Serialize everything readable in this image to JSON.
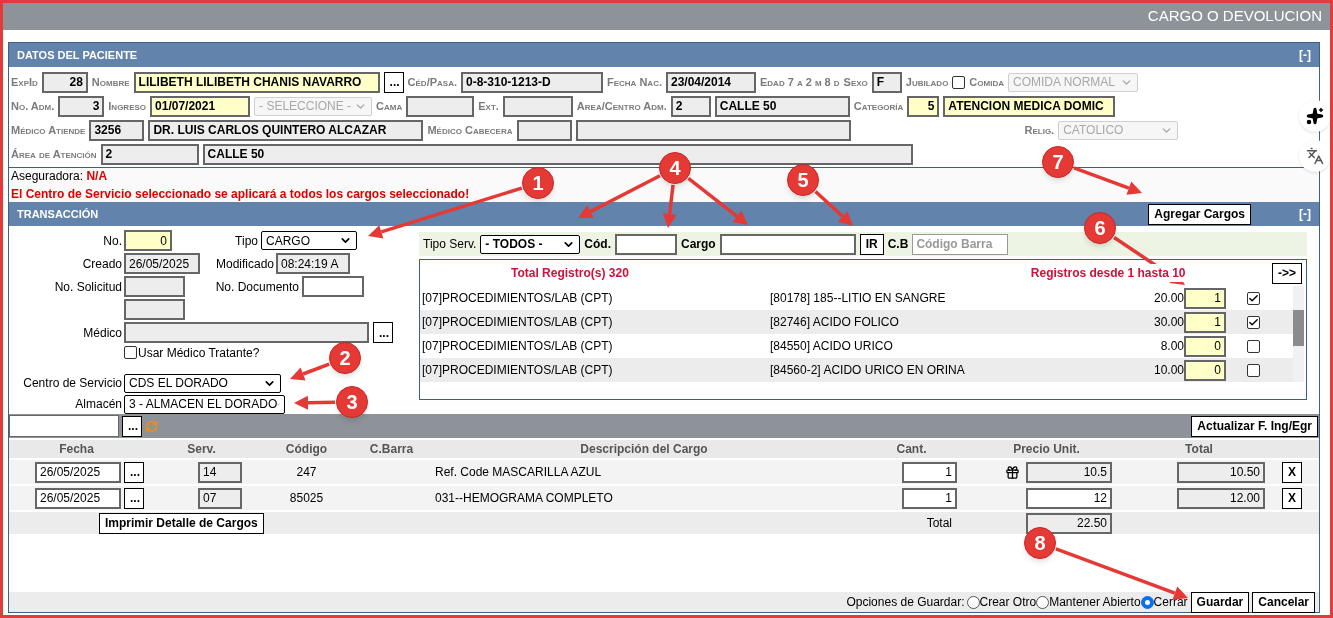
{
  "window": {
    "title": "CARGO O DEVOLUCION"
  },
  "patient": {
    "title": "DATOS DEL PACIENTE",
    "collapse": "[-]",
    "lines": [
      {
        "items": [
          {
            "kind": "label",
            "text": "ExpId"
          },
          {
            "kind": "field",
            "value": "28",
            "highlighted": false
          },
          {
            "kind": "label",
            "text": "Nombre"
          },
          {
            "kind": "field",
            "value": "LILIBETH LILIBETH CHANIS NAVARRO",
            "highlighted": true
          },
          {
            "kind": "button",
            "text": "..."
          },
          {
            "kind": "label",
            "text": "Céd/Pasa."
          },
          {
            "kind": "field",
            "value": "0-8-310-1213-D",
            "highlighted": false
          },
          {
            "kind": "label",
            "text": "Fecha Nac."
          },
          {
            "kind": "field",
            "value": "23/04/2014",
            "highlighted": false
          },
          {
            "kind": "label",
            "text": "Edad 7 a  2 m  8 d"
          },
          {
            "kind": "label",
            "text": "Sexo"
          },
          {
            "kind": "field",
            "value": "F",
            "highlighted": false
          },
          {
            "kind": "label",
            "text": "Jubilado"
          },
          {
            "kind": "checkbox",
            "checked": false
          },
          {
            "kind": "label",
            "text": "Comida"
          },
          {
            "kind": "select",
            "value": "COMIDA NORMAL",
            "disabled": true
          }
        ]
      },
      {
        "items": [
          {
            "kind": "label",
            "text": "No. Adm."
          },
          {
            "kind": "field",
            "value": "3",
            "highlighted": false
          },
          {
            "kind": "label",
            "text": "Ingreso"
          },
          {
            "kind": "field",
            "value": "01/07/2021",
            "highlighted": true
          },
          {
            "kind": "select",
            "value": "- SELECCIONE -",
            "disabled": true
          },
          {
            "kind": "label",
            "text": "Cama"
          },
          {
            "kind": "field",
            "highlighted": false
          },
          {
            "kind": "label",
            "text": "Ext."
          },
          {
            "kind": "field",
            "highlighted": false
          },
          {
            "kind": "label",
            "text": "Area/Centro Adm."
          },
          {
            "kind": "field",
            "value": "2",
            "highlighted": false
          },
          {
            "kind": "field",
            "value": "CALLE 50",
            "highlighted": false
          },
          {
            "kind": "label",
            "text": "Categoría"
          },
          {
            "kind": "field",
            "value": "5",
            "highlighted": true
          },
          {
            "kind": "field",
            "value": "ATENCION MEDICA DOMIC",
            "highlighted": true
          }
        ]
      },
      {
        "items": [
          {
            "kind": "label",
            "text": "Médico Atiende"
          },
          {
            "kind": "field",
            "value": "3256",
            "highlighted": false
          },
          {
            "kind": "field",
            "value": "DR. LUIS CARLOS QUINTERO ALCAZAR",
            "highlighted": false
          },
          {
            "kind": "label",
            "text": "Médico Cabecera"
          },
          {
            "kind": "field",
            "highlighted": false
          },
          {
            "kind": "field",
            "highlighted": false
          },
          {
            "kind": "label",
            "text": "Relig."
          },
          {
            "kind": "select",
            "value": "CATOLICO",
            "disabled": true
          }
        ]
      },
      {
        "items": [
          {
            "kind": "label",
            "text": "Área de Atención"
          },
          {
            "kind": "field",
            "value": "2",
            "highlighted": false
          },
          {
            "kind": "field",
            "value": "CALLE 50",
            "highlighted": false
          }
        ]
      }
    ]
  },
  "insurer": {
    "label": "Aseguradora:",
    "value": "N/A"
  },
  "notice": "El Centro de Servicio seleccionado se aplicará a todos los cargos seleccionado!",
  "transaction": {
    "title": "TRANSACCIÓN",
    "collapse": "[-]",
    "add_button": "Agregar Cargos",
    "form": {
      "no": {
        "label": "No.",
        "value": "0"
      },
      "tipo": {
        "label": "Tipo",
        "value": "CARGO"
      },
      "creado": {
        "label": "Creado",
        "value": "26/05/2025"
      },
      "modificado": {
        "label": "Modificado",
        "value": "08:24:19 A"
      },
      "solicitud": {
        "label": "No. Solicitud"
      },
      "documento": {
        "label": "No. Documento"
      },
      "medico": {
        "label": "Médico",
        "button": "..."
      },
      "tratante": {
        "label": "Usar Médico Tratante?",
        "checked": false
      },
      "centro": {
        "label": "Centro de Servicio",
        "value": "CDS EL DORADO"
      },
      "almacen": {
        "label": "Almacén",
        "value": "3 - ALMACEN EL DORADO"
      }
    },
    "filter": {
      "tipo_label": "Tipo Serv.",
      "tipo_value": "- TODOS -",
      "cod_label": "Cód.",
      "cargo_label": "Cargo",
      "go_button": "IR",
      "cb_label": "C.B",
      "cb_placeholder": "Código Barra"
    },
    "results": {
      "total": "Total Registro(s) 320",
      "range": "Registros desde 1 hasta 10",
      "next_button": "->>",
      "rows": [
        {
          "service": "[07]PROCEDIMIENTOS/LAB (CPT)",
          "item": "[80178] 185--LITIO EN SANGRE",
          "price": "20.00",
          "qty": "1",
          "checked": true
        },
        {
          "service": "[07]PROCEDIMIENTOS/LAB (CPT)",
          "item": "[82746] ACIDO FOLICO",
          "price": "30.00",
          "qty": "1",
          "checked": true
        },
        {
          "service": "[07]PROCEDIMIENTOS/LAB (CPT)",
          "item": "[84550] ACIDO URICO",
          "price": "8.00",
          "qty": "0",
          "checked": false
        },
        {
          "service": "[07]PROCEDIMIENTOS/LAB (CPT)",
          "item": "[84560-2] ACIDO URICO EN ORINA",
          "price": "10.00",
          "qty": "0",
          "checked": false
        }
      ]
    }
  },
  "toolbar": {
    "browse_button": "...",
    "update_button": "Actualizar F. Ing/Egr"
  },
  "charges": {
    "columns": [
      "Fecha",
      "Serv.",
      "Código",
      "C.Barra",
      "Descripción del Cargo",
      "Cant.",
      "Precio Unit.",
      "Total"
    ],
    "rows": [
      {
        "date": "26/05/2025",
        "picker": "...",
        "serv": "14",
        "code": "247",
        "desc": "Ref. Code MASCARILLA AZUL",
        "qty": "1",
        "gift": true,
        "price": "10.5",
        "price_editable": false,
        "total": "10.50",
        "delete": "X"
      },
      {
        "date": "26/05/2025",
        "picker": "...",
        "serv": "07",
        "code": "85025",
        "desc": "031--HEMOGRAMA COMPLETO",
        "qty": "1",
        "gift": false,
        "price": "12",
        "price_editable": true,
        "total": "12.00",
        "delete": "X"
      }
    ],
    "print_button": "Imprimir Detalle de Cargos",
    "total_label": "Total",
    "total": "22.50"
  },
  "footer": {
    "label": "Opciones de Guardar:",
    "options": [
      {
        "label": "Crear Otro",
        "selected": false
      },
      {
        "label": "Mantener Abierto",
        "selected": false
      },
      {
        "label": "Cerrar",
        "selected": true
      }
    ],
    "buttons": [
      "Guardar",
      "Cancelar"
    ]
  },
  "annotations": [
    {
      "label": "1"
    },
    {
      "label": "2"
    },
    {
      "label": "3"
    },
    {
      "label": "4"
    },
    {
      "label": "5"
    },
    {
      "label": "6"
    },
    {
      "label": "7"
    },
    {
      "label": "8"
    }
  ]
}
